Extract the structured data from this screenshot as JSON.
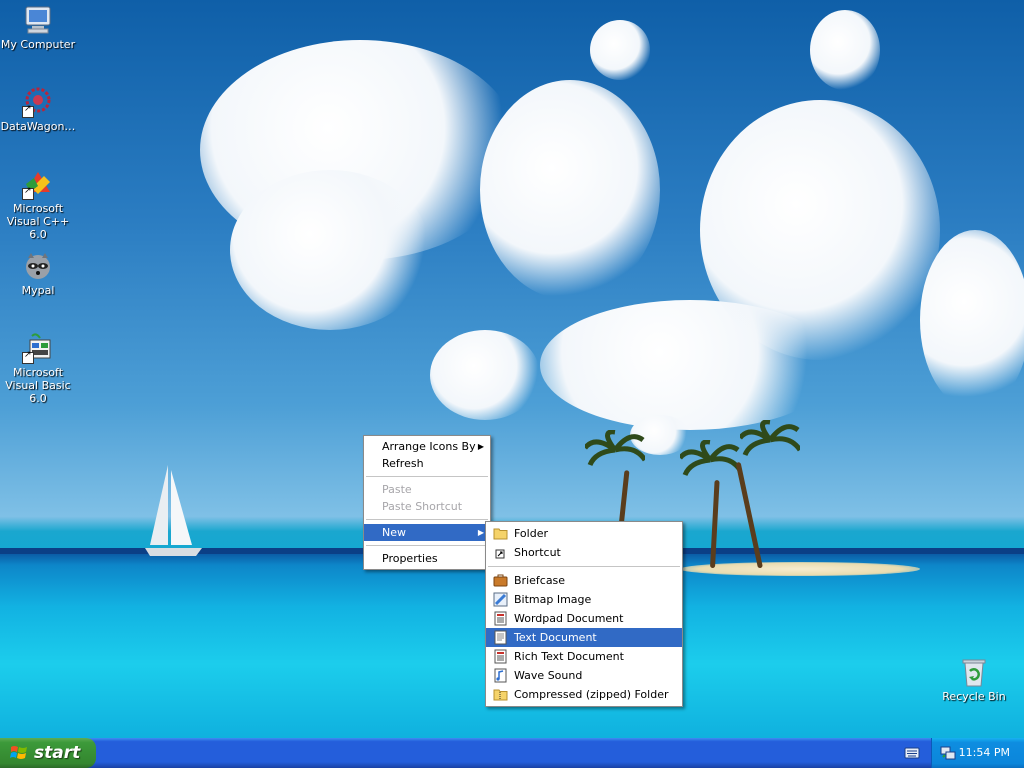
{
  "desktop_icons": [
    {
      "label": "My Computer",
      "icon": "my-computer-icon"
    },
    {
      "label": "DataWagon…",
      "icon": "datawagon-icon"
    },
    {
      "label": "Microsoft Visual C++ 6.0",
      "icon": "visual-cpp-icon"
    },
    {
      "label": "Mypal",
      "icon": "mypal-raccoon-icon"
    },
    {
      "label": "Microsoft Visual Basic 6.0",
      "icon": "visual-basic-icon"
    },
    {
      "label": "Recycle Bin",
      "icon": "recycle-bin-icon"
    }
  ],
  "context_menu": {
    "items": [
      {
        "label": "Arrange Icons By",
        "has_submenu": true,
        "disabled": false
      },
      {
        "label": "Refresh",
        "disabled": false
      },
      {
        "label": "Paste",
        "disabled": true
      },
      {
        "label": "Paste Shortcut",
        "disabled": true
      },
      {
        "label": "New",
        "has_submenu": true,
        "highlighted": true
      },
      {
        "label": "Properties",
        "disabled": false
      }
    ]
  },
  "new_submenu": {
    "items": [
      {
        "label": "Folder",
        "icon": "folder-icon"
      },
      {
        "label": "Shortcut",
        "icon": "shortcut-icon"
      },
      {
        "label": "Briefcase",
        "icon": "briefcase-icon"
      },
      {
        "label": "Bitmap Image",
        "icon": "bitmap-image-icon"
      },
      {
        "label": "Wordpad Document",
        "icon": "wordpad-document-icon"
      },
      {
        "label": "Text Document",
        "icon": "text-document-icon",
        "highlighted": true
      },
      {
        "label": "Rich Text Document",
        "icon": "rich-text-document-icon"
      },
      {
        "label": "Wave Sound",
        "icon": "wave-sound-icon"
      },
      {
        "label": "Compressed (zipped) Folder",
        "icon": "zipped-folder-icon"
      }
    ]
  },
  "taskbar": {
    "start_label": "start",
    "clock": "11:54 PM"
  },
  "colors": {
    "highlight": "#316ac5",
    "taskbar": "#245edb",
    "start_button": "#3c9a3a"
  }
}
